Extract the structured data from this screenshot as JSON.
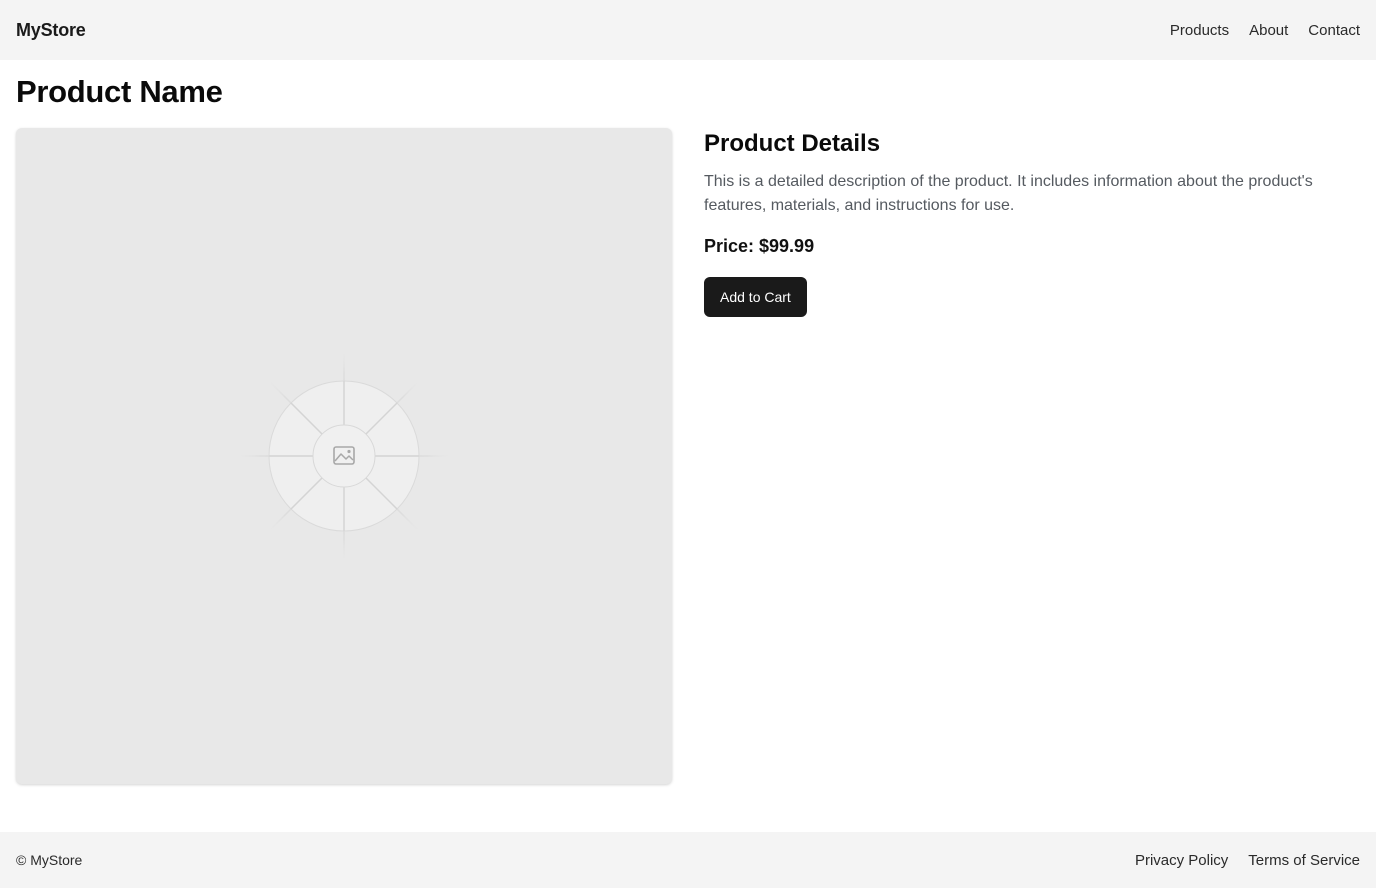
{
  "header": {
    "brand": "MyStore",
    "nav": [
      {
        "label": "Products"
      },
      {
        "label": "About"
      },
      {
        "label": "Contact"
      }
    ]
  },
  "main": {
    "title": "Product Name",
    "image_icon": "image-placeholder-icon",
    "details": {
      "heading": "Product Details",
      "description": "This is a detailed description of the product. It includes information about the product's features, materials, and instructions for use.",
      "price": "Price: $99.99",
      "add_to_cart_label": "Add to Cart"
    }
  },
  "footer": {
    "copyright": "© MyStore",
    "links": [
      {
        "label": "Privacy Policy"
      },
      {
        "label": "Terms of Service"
      }
    ]
  },
  "colors": {
    "header_bg": "#f4f4f4",
    "button_bg": "#1a1a1a",
    "image_bg": "#e8e8e8"
  }
}
